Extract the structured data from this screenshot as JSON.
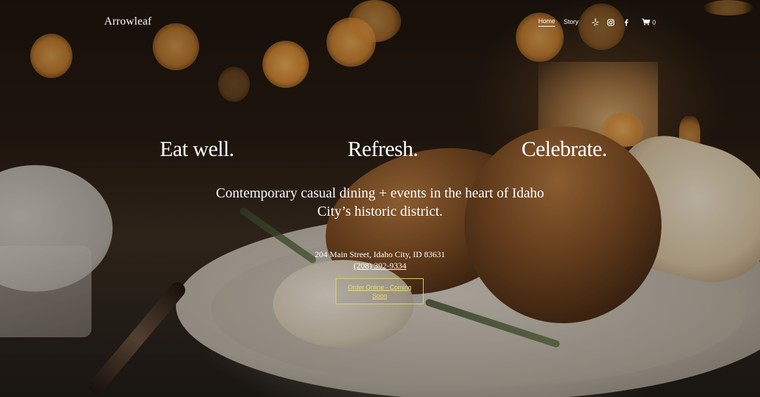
{
  "site": {
    "logo": "Arrowleaf"
  },
  "nav": {
    "links": [
      {
        "label": "Home",
        "active": true
      },
      {
        "label": "Story",
        "active": false
      }
    ],
    "social_icons": [
      "yelp-icon",
      "instagram-icon",
      "facebook-icon"
    ],
    "cart": {
      "icon": "cart-icon",
      "count": "0"
    }
  },
  "hero": {
    "taglines": [
      "Eat well.",
      "Refresh.",
      "Celebrate."
    ],
    "subtitle": "Contemporary casual dining + events in the heart of Idaho City’s historic district.",
    "address": "204 Main Street, Idaho City, ID 83631",
    "phone": "(208) 392-9334",
    "order_button": "Order Online - Coming Soon"
  },
  "colors": {
    "text": "#ffffff",
    "button_border": "#d9d46a",
    "button_text": "#e6df7a"
  }
}
